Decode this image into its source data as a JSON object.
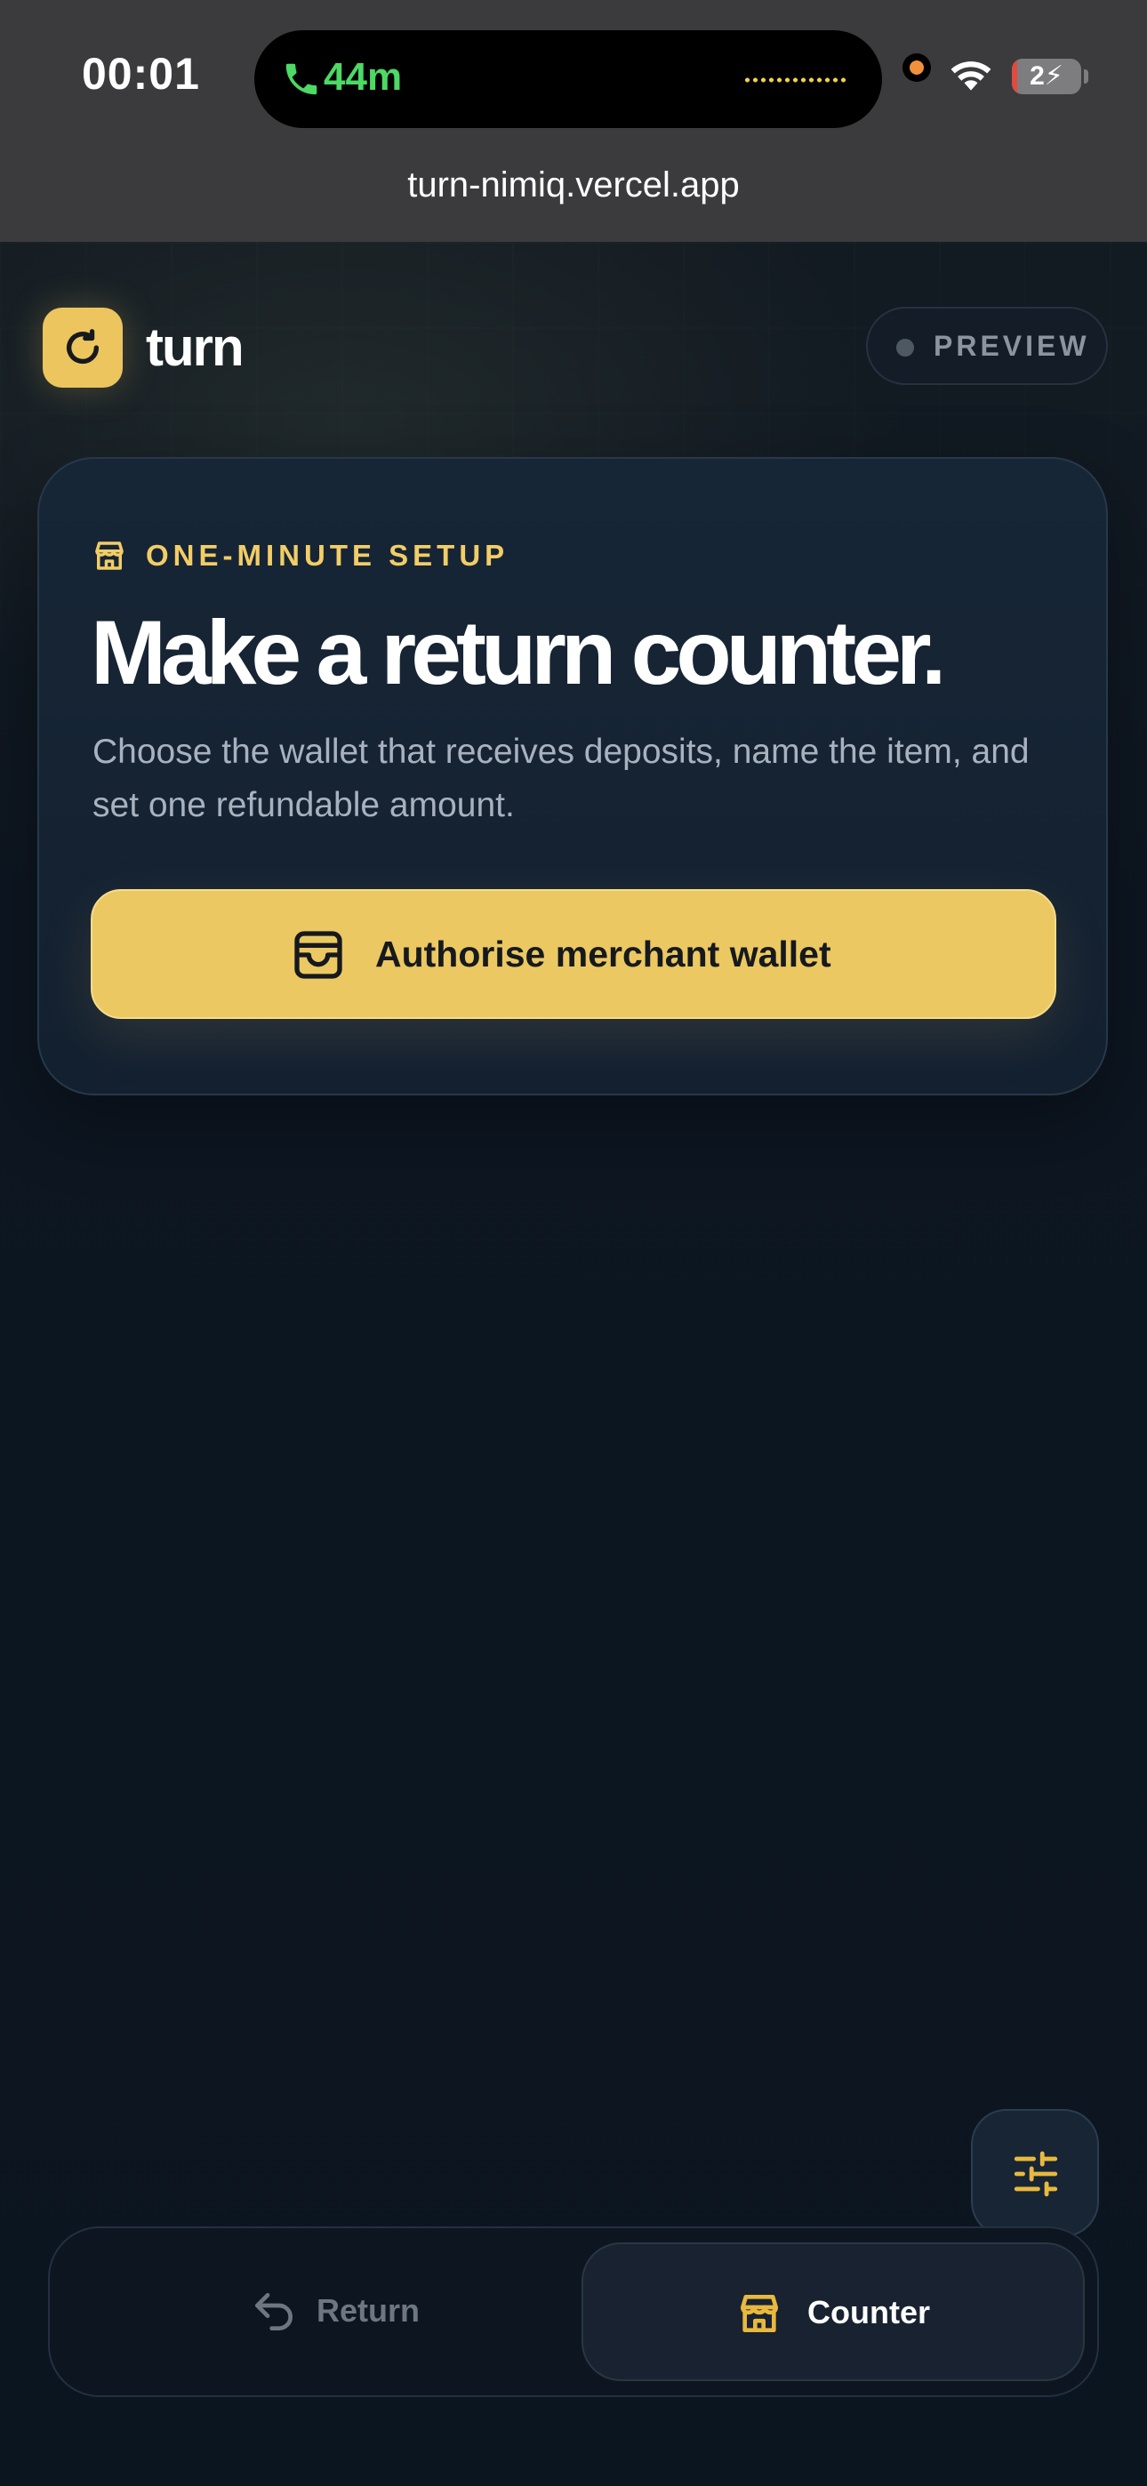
{
  "status_bar": {
    "time": "00:01",
    "call_duration": "44m",
    "battery_level": "2",
    "url": "turn-nimiq.vercel.app"
  },
  "header": {
    "brand": "turn",
    "badge": "PREVIEW"
  },
  "card": {
    "eyebrow": "ONE-MINUTE SETUP",
    "headline": "Make a return counter.",
    "description": "Choose the wallet that receives deposits, name the item, and set one refundable amount.",
    "cta_label": "Authorise merchant wallet"
  },
  "bottom_nav": {
    "tabs": [
      {
        "label": "Return",
        "icon": "return-arrow-icon",
        "active": false
      },
      {
        "label": "Counter",
        "icon": "store-icon",
        "active": true
      }
    ]
  },
  "colors": {
    "accent": "#ecc55f",
    "background": "#0c1520",
    "card": "#172636",
    "call_green": "#4cd964"
  },
  "icons": {
    "settings": "sliders-icon",
    "logo": "refresh-arrow-icon"
  }
}
